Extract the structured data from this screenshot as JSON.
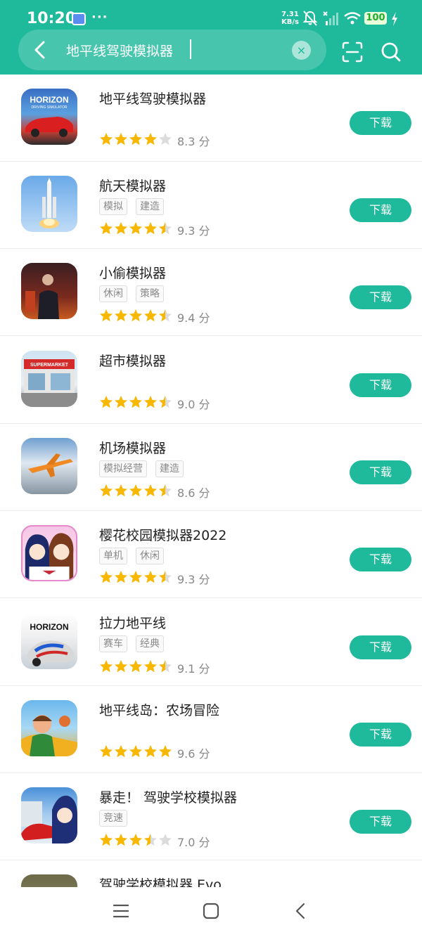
{
  "status_bar": {
    "time": "10:20",
    "dots": "···",
    "net_speed_value": "7.31",
    "net_speed_unit": "KB/s",
    "battery": "100",
    "icons": [
      "notification-app-icon",
      "mute-icon",
      "signal-icon",
      "wifi-icon",
      "battery-icon",
      "charging-icon"
    ]
  },
  "search": {
    "query": "地平线驾驶模拟器",
    "icons": [
      "back-arrow-icon",
      "clear-icon",
      "scan-icon",
      "search-icon"
    ]
  },
  "colors": {
    "brand": "#1fb99b",
    "star": "#f9b800",
    "star_empty": "#dcdcdc"
  },
  "download_label": "下载",
  "apps": [
    {
      "title": "地平线驾驶模拟器",
      "tags": [],
      "rating": 4,
      "score": "8.3 分"
    },
    {
      "title": "航天模拟器",
      "tags": [
        "模拟",
        "建造"
      ],
      "rating": 4.5,
      "score": "9.3 分"
    },
    {
      "title": "小偷模拟器",
      "tags": [
        "休闲",
        "策略"
      ],
      "rating": 4.5,
      "score": "9.4 分"
    },
    {
      "title": "超市模拟器",
      "tags": [],
      "rating": 4.5,
      "score": "9.0 分"
    },
    {
      "title": "机场模拟器",
      "tags": [
        "模拟经营",
        "建造"
      ],
      "rating": 4.5,
      "score": "8.6 分"
    },
    {
      "title": "樱花校园模拟器2022",
      "tags": [
        "单机",
        "休闲"
      ],
      "rating": 4.5,
      "score": "9.3 分"
    },
    {
      "title": "拉力地平线",
      "tags": [
        "赛车",
        "经典"
      ],
      "rating": 4.5,
      "score": "9.1 分"
    },
    {
      "title": "地平线岛：农场冒险",
      "tags": [],
      "rating": 5,
      "score": "9.6 分"
    },
    {
      "title": "暴走！ 驾驶学校模拟器",
      "tags": [
        "竞速"
      ],
      "rating": 3.5,
      "score": "7.0 分"
    },
    {
      "title": "驾驶学校模拟器 Evo",
      "tags": [],
      "rating": null,
      "score": ""
    }
  ],
  "app_icon_text": {
    "horizon_logo": "HORIZON",
    "horizon_sub": "DRIVING SIMULATOR",
    "supermarket": "SUPERMARKET",
    "rally_logo": "HORIZON"
  },
  "nav": {
    "icons": [
      "menu-icon",
      "home-icon",
      "back-icon"
    ]
  }
}
